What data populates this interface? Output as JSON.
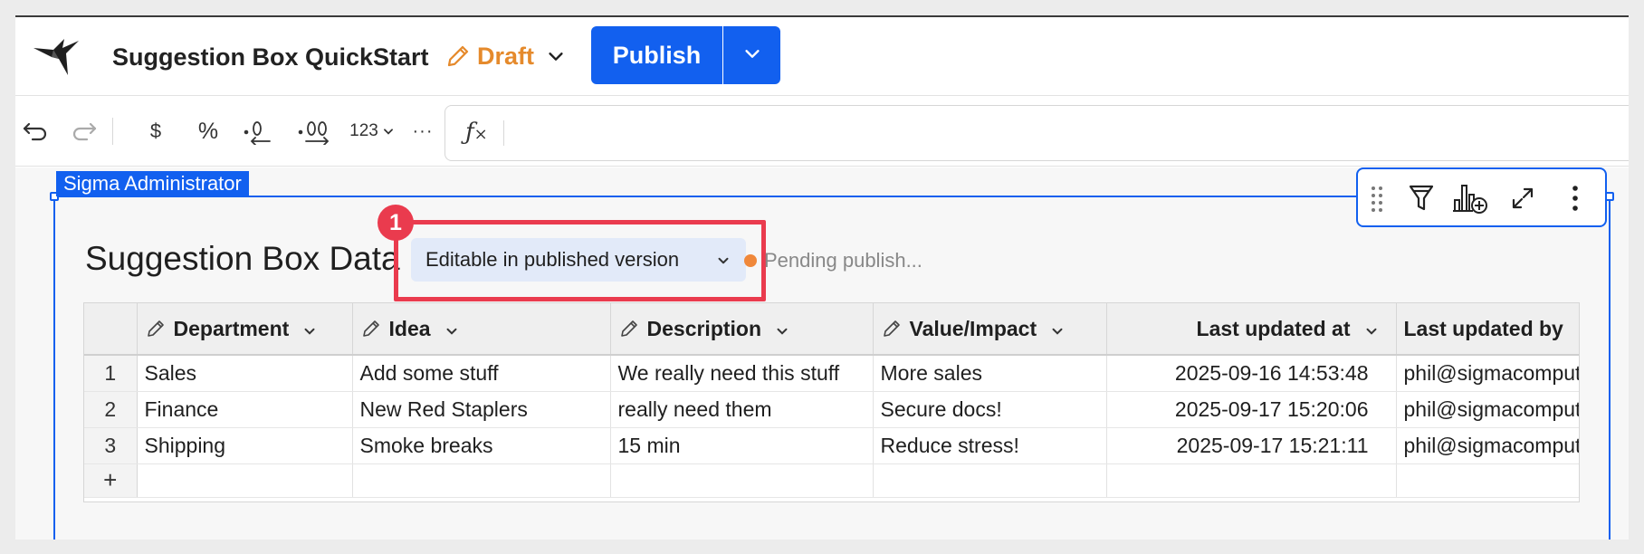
{
  "header": {
    "doc_title": "Suggestion Box QuickStart",
    "status": "Draft",
    "publish_label": "Publish"
  },
  "toolbar": {
    "currency_label": "$",
    "percent_label": "%",
    "number_format_label": "123",
    "more_label": "···",
    "formula_icon": "fx"
  },
  "canvas": {
    "owner_tag": "Sigma Administrator",
    "table_title": "Suggestion Box Data",
    "editable_pill": "Editable in published version",
    "callout_number": "1",
    "pending_text": "Pending publish..."
  },
  "table": {
    "columns": [
      {
        "label": "Department",
        "editable": true
      },
      {
        "label": "Idea",
        "editable": true
      },
      {
        "label": "Description",
        "editable": true
      },
      {
        "label": "Value/Impact",
        "editable": true
      },
      {
        "label": "Last updated at",
        "editable": false
      },
      {
        "label": "Last updated by",
        "editable": false
      }
    ],
    "rows": [
      {
        "num": "1",
        "cells": [
          "Sales",
          "Add some stuff",
          "We really need this stuff",
          "More sales",
          "2025-09-16 14:53:48",
          "phil@sigmacomputing.com"
        ]
      },
      {
        "num": "2",
        "cells": [
          "Finance",
          "New Red Staplers",
          "really need them",
          "Secure docs!",
          "2025-09-17 15:20:06",
          "phil@sigmacomputing.com"
        ]
      },
      {
        "num": "3",
        "cells": [
          "Shipping",
          "Smoke breaks",
          "15 min",
          "Reduce stress!",
          "2025-09-17 15:21:11",
          "phil@sigmacomputing.com"
        ]
      }
    ],
    "add_row_label": "+"
  },
  "colors": {
    "accent": "#1260ef",
    "draft": "#e58a2c",
    "highlight": "#ea3b4e",
    "pending_dot": "#f0883a"
  }
}
